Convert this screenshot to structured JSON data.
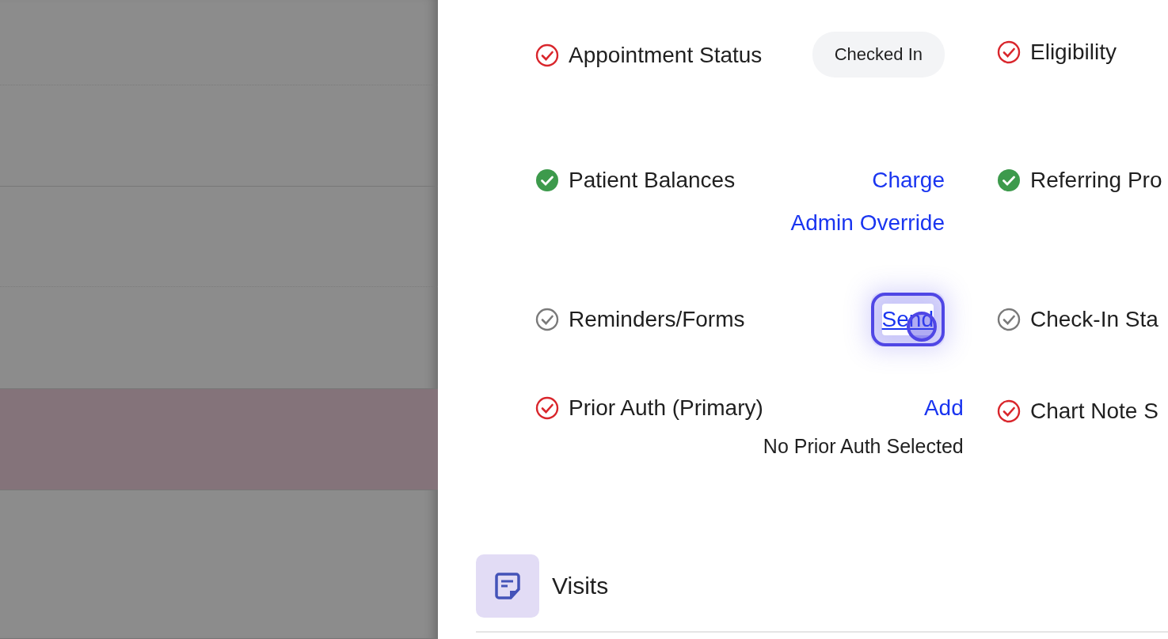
{
  "backdrop_rows": [
    {
      "selected": false
    },
    {
      "selected": false
    },
    {
      "selected": false
    },
    {
      "selected": false
    },
    {
      "selected": true
    },
    {
      "selected": false
    }
  ],
  "checklist_left": [
    {
      "label": "Appointment Status",
      "checked": false,
      "color": "#d9262c",
      "badge": "Checked In"
    },
    {
      "label": "Patient Balances",
      "checked": true,
      "color": "#3d9a4c",
      "actions": [
        {
          "label": "Charge",
          "focused": false
        },
        {
          "label": "Admin Override",
          "focused": false
        }
      ]
    },
    {
      "label": "Reminders/Forms",
      "checked": false,
      "color": "#7a7a7a",
      "actions": [
        {
          "label": "Send",
          "focused": true
        }
      ]
    },
    {
      "label": "Prior Auth (Primary)",
      "checked": false,
      "color": "#d9262c",
      "actions": [
        {
          "label": "Add",
          "focused": false
        }
      ],
      "note": "No Prior Auth Selected"
    }
  ],
  "checklist_right": [
    {
      "label": "Eligibility",
      "checked": false,
      "color": "#d9262c"
    },
    {
      "label": "Referring Pro",
      "checked": true,
      "color": "#3d9a4c"
    },
    {
      "label": "Check-In Sta",
      "checked": false,
      "color": "#7a7a7a"
    },
    {
      "label": "Chart Note S",
      "checked": false,
      "color": "#d9262c"
    }
  ],
  "section": {
    "title": "Visits"
  }
}
